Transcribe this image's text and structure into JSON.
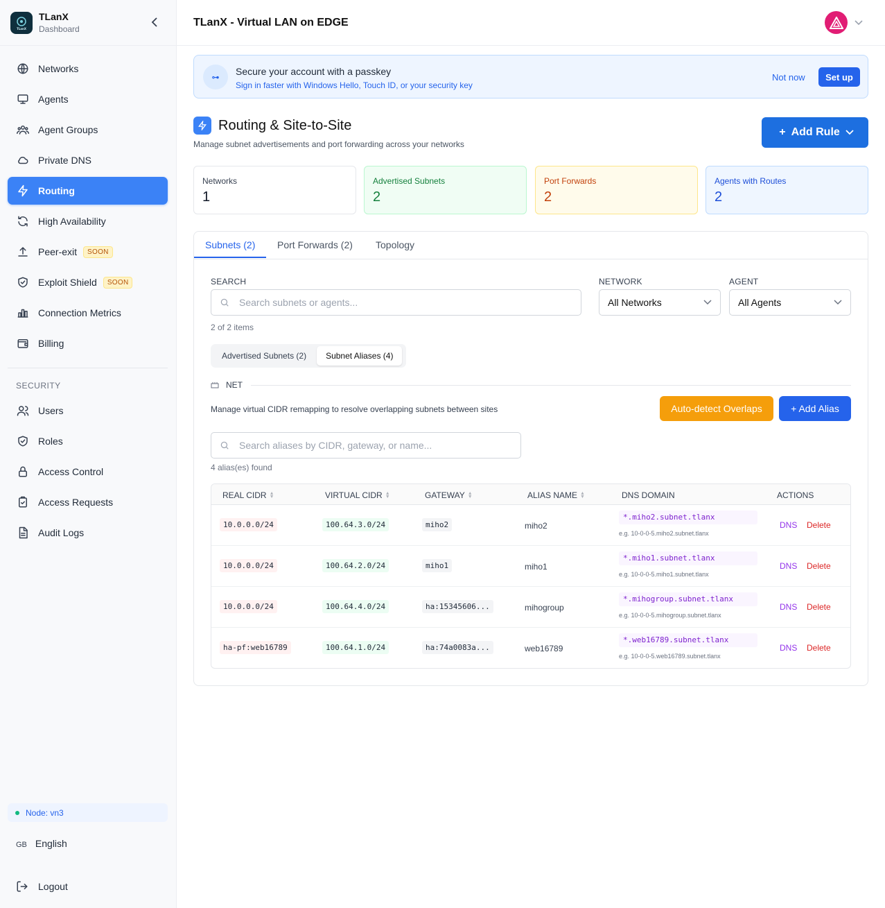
{
  "brand": {
    "name": "TLanX",
    "subtitle": "Dashboard",
    "logo_text": "TLanX"
  },
  "sidebar": {
    "items": [
      {
        "label": "Networks",
        "icon": "globe-icon"
      },
      {
        "label": "Agents",
        "icon": "monitor-icon"
      },
      {
        "label": "Agent Groups",
        "icon": "users-group-icon"
      },
      {
        "label": "Private DNS",
        "icon": "cloud-icon"
      },
      {
        "label": "Routing",
        "icon": "bolt-icon",
        "active": true
      },
      {
        "label": "High Availability",
        "icon": "refresh-icon"
      },
      {
        "label": "Peer-exit",
        "icon": "upload-icon",
        "badge": "SOON"
      },
      {
        "label": "Exploit Shield",
        "icon": "shield-check-icon",
        "badge": "SOON"
      },
      {
        "label": "Connection Metrics",
        "icon": "bar-chart-icon"
      },
      {
        "label": "Billing",
        "icon": "wallet-icon"
      }
    ],
    "security_label": "SECURITY",
    "security_items": [
      {
        "label": "Users",
        "icon": "users-icon"
      },
      {
        "label": "Roles",
        "icon": "shield-icon"
      },
      {
        "label": "Access Control",
        "icon": "lock-icon"
      },
      {
        "label": "Access Requests",
        "icon": "clipboard-check-icon"
      },
      {
        "label": "Audit Logs",
        "icon": "file-text-icon"
      }
    ],
    "node": "Node: vn3",
    "language_code": "GB",
    "language": "English",
    "logout": "Logout"
  },
  "header": {
    "title": "TLanX - Virtual LAN on EDGE"
  },
  "banner": {
    "icon_text": "⊶",
    "title": "Secure your account with a passkey",
    "subtitle": "Sign in faster with Windows Hello, Touch ID, or your security key",
    "not_now": "Not now",
    "setup": "Set up"
  },
  "page": {
    "title": "Routing & Site-to-Site",
    "subtitle": "Manage subnet advertisements and port forwarding across your networks",
    "add_rule_plus": "+",
    "add_rule": "Add Rule"
  },
  "stats": [
    {
      "label": "Networks",
      "value": "1",
      "bg": "#ffffff",
      "border": "#e5e7eb",
      "label_color": "#374151",
      "value_color": "#111827"
    },
    {
      "label": "Advertised Subnets",
      "value": "2",
      "bg": "#f0fdf4",
      "border": "#bbf7d0",
      "label_color": "#15803d",
      "value_color": "#15803d"
    },
    {
      "label": "Port Forwards",
      "value": "2",
      "bg": "#fffbeb",
      "border": "#fde68a",
      "label_color": "#c2410c",
      "value_color": "#c2410c"
    },
    {
      "label": "Agents with Routes",
      "value": "2",
      "bg": "#eff6ff",
      "border": "#bfdbfe",
      "label_color": "#1d4ed8",
      "value_color": "#1d4ed8"
    }
  ],
  "tabs": [
    {
      "label": "Subnets (2)",
      "active": true
    },
    {
      "label": "Port Forwards (2)"
    },
    {
      "label": "Topology"
    }
  ],
  "filters": {
    "search_label": "SEARCH",
    "search_placeholder": "Search subnets or agents...",
    "network_label": "NETWORK",
    "network_value": "All Networks",
    "agent_label": "AGENT",
    "agent_value": "All Agents",
    "items_count": "2 of 2 items"
  },
  "segments": [
    {
      "label": "Advertised Subnets (2)"
    },
    {
      "label": "Subnet Aliases (4)",
      "active": true
    }
  ],
  "aliases": {
    "section_label": "NET",
    "description": "Manage virtual CIDR remapping to resolve overlapping subnets between sites",
    "auto_detect": "Auto-detect Overlaps",
    "add_alias": "+ Add Alias",
    "search_placeholder": "Search aliases by CIDR, gateway, or name...",
    "found": "4 alias(es) found",
    "columns": [
      "REAL CIDR",
      "VIRTUAL CIDR",
      "GATEWAY",
      "ALIAS NAME",
      "DNS DOMAIN",
      "ACTIONS"
    ],
    "rows": [
      {
        "real": "10.0.0.0/24",
        "virtual": "100.64.3.0/24",
        "gateway": "miho2",
        "name": "miho2",
        "dns": "*.miho2.subnet.tlanx",
        "example": "e.g. 10-0-0-5.miho2.subnet.tlanx"
      },
      {
        "real": "10.0.0.0/24",
        "virtual": "100.64.2.0/24",
        "gateway": "miho1",
        "name": "miho1",
        "dns": "*.miho1.subnet.tlanx",
        "example": "e.g. 10-0-0-5.miho1.subnet.tlanx"
      },
      {
        "real": "10.0.0.0/24",
        "virtual": "100.64.4.0/24",
        "gateway": "ha:15345606...",
        "name": "mihogroup",
        "dns": "*.mihogroup.subnet.tlanx",
        "example": "e.g. 10-0-0-5.mihogroup.subnet.tlanx"
      },
      {
        "real": "ha-pf:web16789",
        "virtual": "100.64.1.0/24",
        "gateway": "ha:74a0083a...",
        "name": "web16789",
        "dns": "*.web16789.subnet.tlanx",
        "example": "e.g. 10-0-0-5.web16789.subnet.tlanx"
      }
    ],
    "action_dns": "DNS",
    "action_delete": "Delete"
  }
}
